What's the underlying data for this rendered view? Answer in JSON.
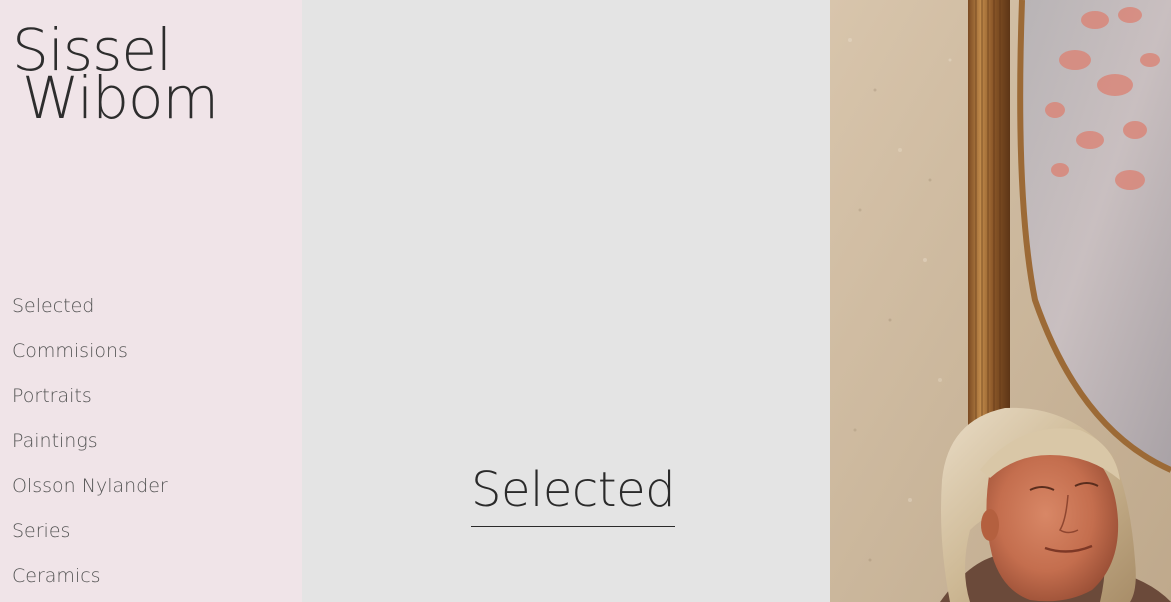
{
  "site": {
    "title_line1": "Sissel",
    "title_line2": "Wibom"
  },
  "nav": {
    "items": [
      {
        "label": "Selected"
      },
      {
        "label": "Commisions"
      },
      {
        "label": "Portraits"
      },
      {
        "label": "Paintings"
      },
      {
        "label": "Olsson Nylander"
      },
      {
        "label": "Series"
      },
      {
        "label": "Ceramics"
      }
    ]
  },
  "main": {
    "heading": "Selected"
  },
  "colors": {
    "sidebar_bg": "#f0e4e8",
    "center_bg": "#e4e4e4",
    "text_dark": "#2d2d2d",
    "nav_text": "#555555"
  },
  "artwork": {
    "subject": "painted portrait of a woman before a gilded framed painting"
  }
}
